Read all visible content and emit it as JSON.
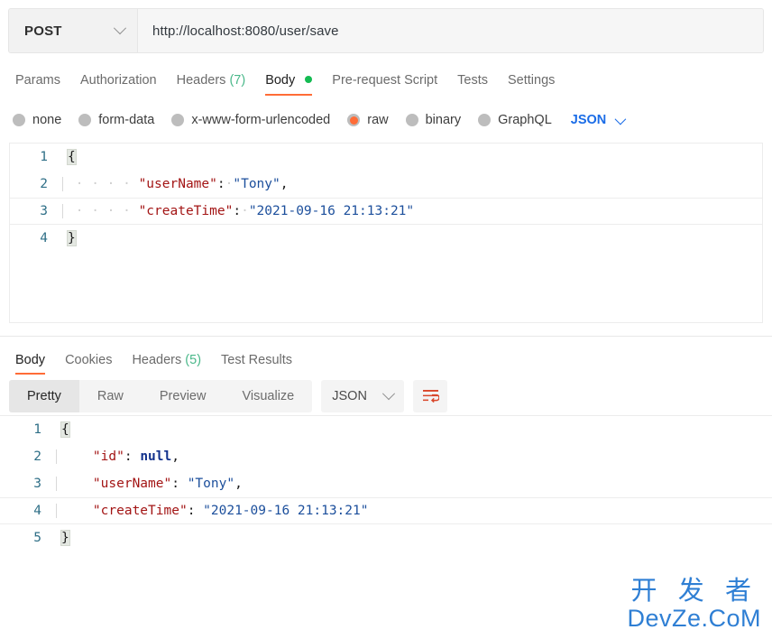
{
  "urlbar": {
    "method": "POST",
    "method_chevron_icon": "chevron-down-icon",
    "url": "http://localhost:8080/user/save"
  },
  "request_tabs": [
    {
      "label": "Params",
      "active": false
    },
    {
      "label": "Authorization",
      "active": false
    },
    {
      "label": "Headers",
      "count": "(7)",
      "active": false
    },
    {
      "label": "Body",
      "active": true,
      "dot": true
    },
    {
      "label": "Pre-request Script",
      "active": false
    },
    {
      "label": "Tests",
      "active": false
    },
    {
      "label": "Settings",
      "active": false
    }
  ],
  "body_types": {
    "options": [
      {
        "label": "none",
        "selected": false
      },
      {
        "label": "form-data",
        "selected": false
      },
      {
        "label": "x-www-form-urlencoded",
        "selected": false
      },
      {
        "label": "raw",
        "selected": true
      },
      {
        "label": "binary",
        "selected": false
      },
      {
        "label": "GraphQL",
        "selected": false
      }
    ],
    "format_label": "JSON",
    "format_chevron_icon": "chevron-down-icon"
  },
  "request_body": {
    "lines": [
      {
        "number": "1",
        "active": false
      },
      {
        "number": "2",
        "active": false
      },
      {
        "number": "3",
        "active": true
      },
      {
        "number": "4",
        "active": false
      }
    ],
    "line1_brace": "{",
    "line2_key": "\"userName\"",
    "line2_colon": ":",
    "line2_value": "\"Tony\"",
    "line2_comma": ",",
    "line3_key": "\"createTime\"",
    "line3_colon": ":",
    "line3_value": "\"2021-09-16 21:13:21\"",
    "line4_brace": "}"
  },
  "response_tabs": [
    {
      "label": "Body",
      "active": true
    },
    {
      "label": "Cookies",
      "active": false
    },
    {
      "label": "Headers",
      "count": "(5)",
      "active": false
    },
    {
      "label": "Test Results",
      "active": false
    }
  ],
  "response_toolbar": {
    "segments": [
      {
        "label": "Pretty",
        "active": true
      },
      {
        "label": "Raw",
        "active": false
      },
      {
        "label": "Preview",
        "active": false
      },
      {
        "label": "Visualize",
        "active": false
      }
    ],
    "format_label": "JSON",
    "format_chevron_icon": "chevron-down-icon",
    "wrap_icon": "word-wrap-icon"
  },
  "response_body": {
    "lines": [
      {
        "number": "1",
        "active": false
      },
      {
        "number": "2",
        "active": false
      },
      {
        "number": "3",
        "active": false
      },
      {
        "number": "4",
        "active": true
      },
      {
        "number": "5",
        "active": false
      }
    ],
    "line1_brace": "{",
    "line2_key": "\"id\"",
    "line2_colon": ": ",
    "line2_value": "null",
    "line2_comma": ",",
    "line3_key": "\"userName\"",
    "line3_colon": ": ",
    "line3_value": "\"Tony\"",
    "line3_comma": ",",
    "line4_key": "\"createTime\"",
    "line4_colon": ": ",
    "line4_value": "\"2021-09-16 21:13:21\"",
    "line5_brace": "}"
  },
  "watermark": {
    "cn": "开 发 者",
    "en": "DevZe.CoM"
  },
  "colors": {
    "accent_orange": "#ff6c37",
    "green_dot": "#14bb52",
    "link_blue": "#1a6ce7",
    "json_key": "#a31515",
    "json_string": "#1c4f9c",
    "json_null": "#12318c",
    "gutter_number": "#2f6f87",
    "watermark_blue": "#2f7fd4"
  }
}
